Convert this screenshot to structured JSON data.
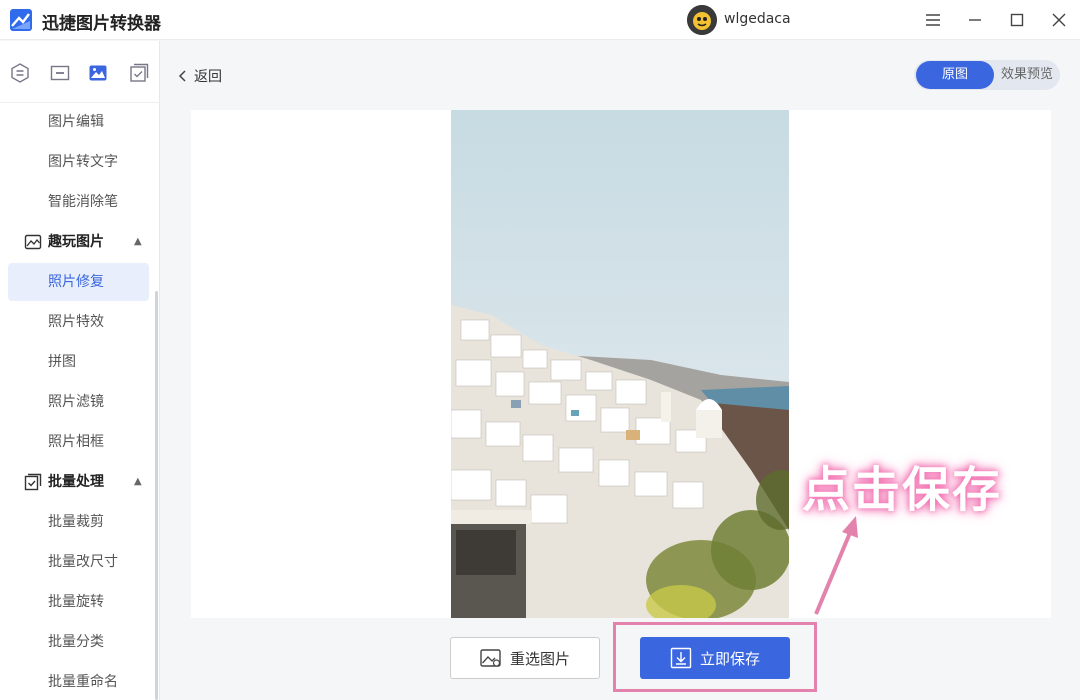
{
  "app": {
    "title": "迅捷图片转换器",
    "username": "wlgedaca"
  },
  "window_controls": [
    "menu-icon",
    "minimize-icon",
    "maximize-icon",
    "close-icon"
  ],
  "sidebar": {
    "tab_icons": [
      "convert-icon",
      "layout-icon",
      "image-icon",
      "batch-icon"
    ],
    "items_top": [
      "图片编辑",
      "图片转文字",
      "智能消除笔"
    ],
    "group_fun": {
      "label": "趣玩图片",
      "items": [
        "照片修复",
        "照片特效",
        "拼图",
        "照片滤镜",
        "照片相框"
      ]
    },
    "group_batch": {
      "label": "批量处理",
      "items": [
        "批量裁剪",
        "批量改尺寸",
        "批量旋转",
        "批量分类",
        "批量重命名"
      ]
    },
    "active_item": "照片修复"
  },
  "main": {
    "back_label": "返回",
    "toggle": {
      "original": "原图",
      "preview": "效果预览"
    },
    "reselect_label": "重选图片",
    "save_label": "立即保存",
    "annotation": "点击保存"
  },
  "colors": {
    "accent": "#3a66e0",
    "highlight": "#e383ad"
  }
}
